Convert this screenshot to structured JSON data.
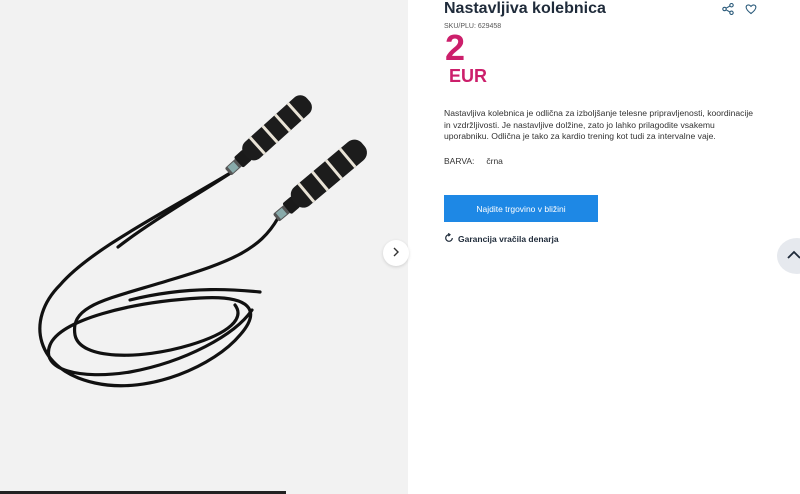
{
  "product": {
    "title": "Nastavljiva kolebnica",
    "sku": "SKU/PLU: 629458",
    "price_value": "2",
    "price_currency": "EUR",
    "description": "Nastavljiva kolebnica je odlična za izboljšanje telesne pripravljenosti, koordinacije in vzdržljivosti. Je nastavljive dolžine, zato jo lahko prilagodite vsakemu uporabniku. Odlična je tako za kardio trening kot tudi za intervalne vaje.",
    "attributes": [
      {
        "label": "BARVA:",
        "value": "črna"
      }
    ]
  },
  "actions": {
    "find_store_label": "Najdite trgovino v bližini",
    "guarantee_label": "Garancija vračila denarja"
  },
  "icons": {
    "share": "share-icon",
    "favorite": "heart-icon",
    "next": "chevron-right-icon",
    "guarantee": "refresh-icon",
    "scroll_top": "chevron-up-icon"
  },
  "colors": {
    "price": "#cc1f6b",
    "button": "#1e88e5",
    "title": "#1f2b3a",
    "icon": "#2a5a7a"
  }
}
